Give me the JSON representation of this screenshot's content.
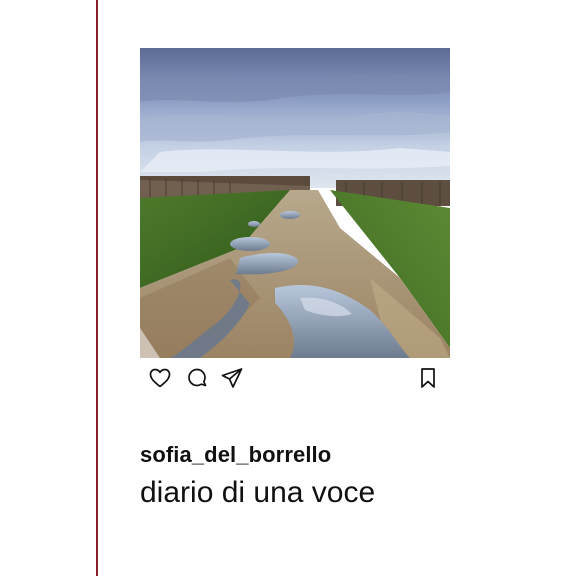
{
  "post": {
    "image_description_icon": "landscape-photo",
    "username": "sofia_del_borrello",
    "caption": "diario di una voce"
  },
  "actions": {
    "like_icon": "heart-icon",
    "comment_icon": "comment-icon",
    "share_icon": "send-icon",
    "save_icon": "bookmark-icon"
  },
  "colors": {
    "spine": "#8a1f2b",
    "text": "#111111"
  }
}
